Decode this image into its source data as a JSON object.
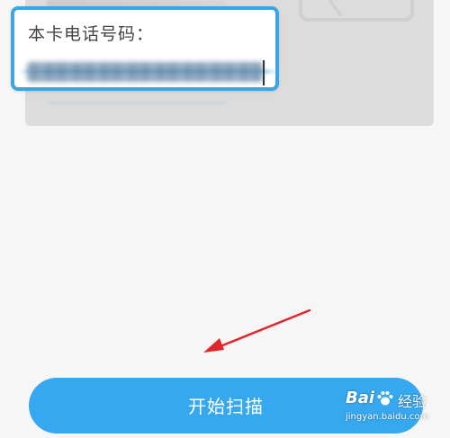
{
  "callout": {
    "label": "本卡电话号码："
  },
  "action": {
    "scan_label": "开始扫描"
  },
  "watermark": {
    "brand": "Bai",
    "tail": "经验",
    "url": "jingyan.baidu.com"
  },
  "colors": {
    "accent": "#36a8ef",
    "callout_border": "#3aa6e6",
    "arrow": "#e0262b",
    "background": "#f6f6f6",
    "card": "#dcdcdc"
  }
}
